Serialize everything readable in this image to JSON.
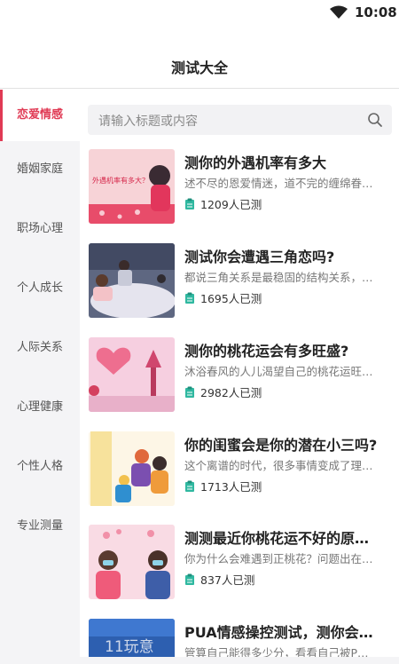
{
  "status_bar": {
    "time": "10:08",
    "wifi_icon": "wifi-icon"
  },
  "header": {
    "title": "测试大全"
  },
  "sidebar": {
    "items": [
      {
        "label": "恋爱情感",
        "active": true
      },
      {
        "label": "婚姻家庭",
        "active": false
      },
      {
        "label": "职场心理",
        "active": false
      },
      {
        "label": "个人成长",
        "active": false
      },
      {
        "label": "人际关系",
        "active": false
      },
      {
        "label": "心理健康",
        "active": false
      },
      {
        "label": "个性人格",
        "active": false
      },
      {
        "label": "专业测量",
        "active": false
      }
    ]
  },
  "search": {
    "placeholder": "请输入标题或内容",
    "icon": "search-icon"
  },
  "cards": [
    {
      "title": "测你的外遇机率有多大",
      "desc": "述不尽的恩爱情迷，道不完的缠绵眷…",
      "count": "1209人已测",
      "thumb_text": "外遇机率有多大？"
    },
    {
      "title": "测试你会遭遇三角恋吗?",
      "desc": "都说三角关系是最稳固的结构关系，…",
      "count": "1695人已测",
      "thumb_text": ""
    },
    {
      "title": "测你的桃花运会有多旺盛?",
      "desc": "沐浴春风的人儿渴望自己的桃花运旺…",
      "count": "2982人已测",
      "thumb_text": ""
    },
    {
      "title": "你的闺蜜会是你的潜在小三吗?",
      "desc": "这个离谱的时代，很多事情变成了理…",
      "count": "1713人已测",
      "thumb_text": ""
    },
    {
      "title": "测测最近你桃花运不好的原…",
      "desc": "你为什么会难遇到正桃花？问题出在…",
      "count": "837人已测",
      "thumb_text": ""
    },
    {
      "title": "PUA情感操控测试，测你会…",
      "desc": "管算自己能得多少分，看看自己被P…",
      "count": "",
      "thumb_text": ""
    }
  ],
  "watermark": "11玩意",
  "colors": {
    "accent": "#e03a54",
    "counter_icon": "#2fb8a0"
  }
}
